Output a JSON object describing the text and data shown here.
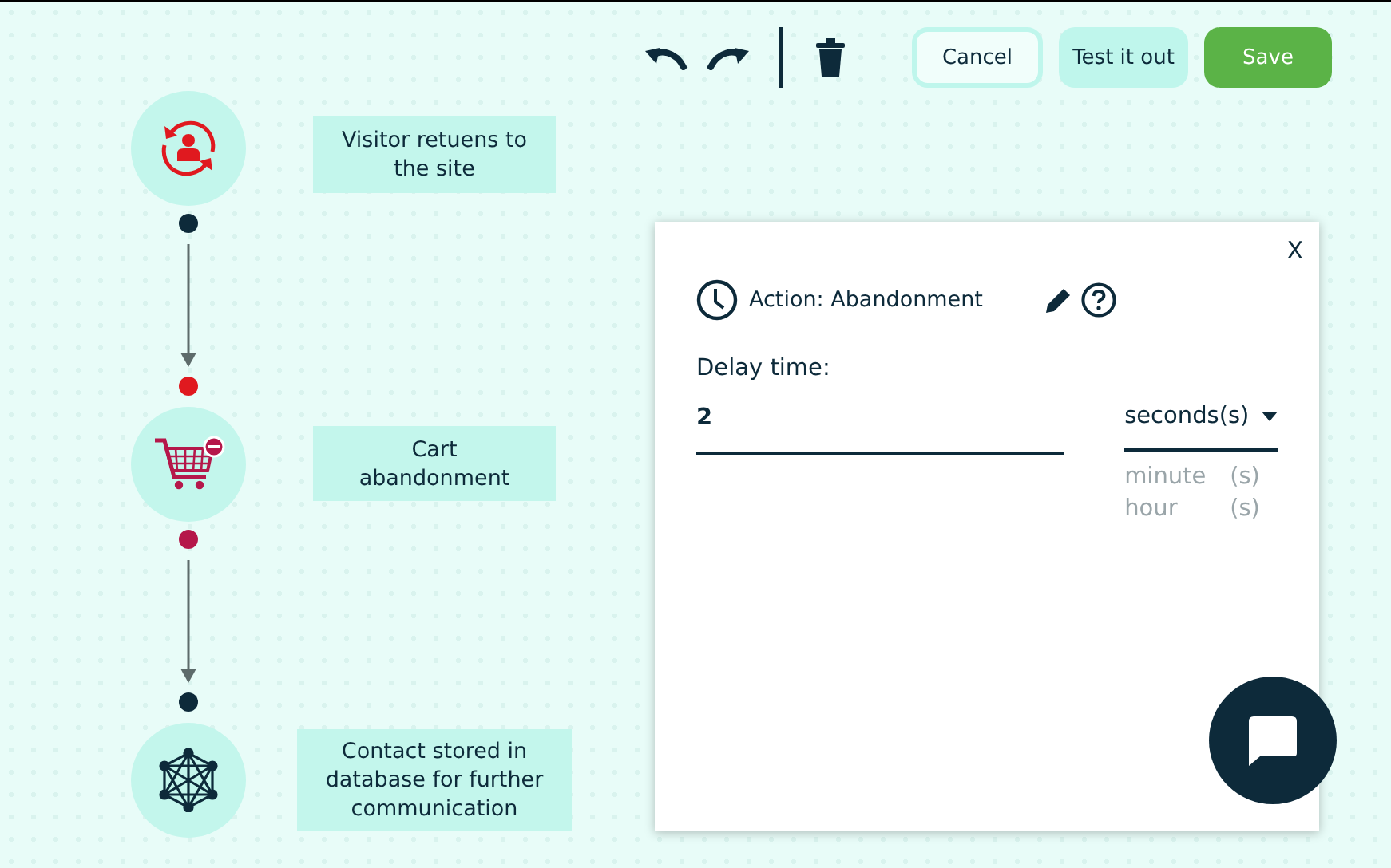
{
  "toolbar": {
    "buttons": [
      {
        "label": "Cancel",
        "kind": "outline"
      },
      {
        "label": "Test it out",
        "kind": "soft"
      },
      {
        "label": "Save",
        "kind": "primary"
      }
    ]
  },
  "flow": {
    "nodes": [
      {
        "kind": "returning-visitor",
        "label": "Visitor retuens to the site"
      },
      {
        "kind": "cart",
        "label": "Cart abandonment"
      },
      {
        "kind": "network",
        "label": "Contact stored in database for further communication"
      }
    ],
    "connectors": [
      {
        "dots": [
          {
            "color": "#0d2a3a"
          },
          {
            "color": "#e0191f"
          }
        ]
      },
      {
        "dots": [
          {
            "color": "#b5174a"
          },
          {
            "color": "#0d2a3a"
          }
        ]
      }
    ]
  },
  "panel": {
    "close": "X",
    "title": "Action: Abandonment",
    "delay": {
      "label": "Delay time:",
      "value": "2"
    },
    "unit": {
      "value": "seconds(s)",
      "options": [
        {
          "label": "minute",
          "suffix": "(s)"
        },
        {
          "label": "hour",
          "suffix": "(s)"
        }
      ]
    }
  }
}
